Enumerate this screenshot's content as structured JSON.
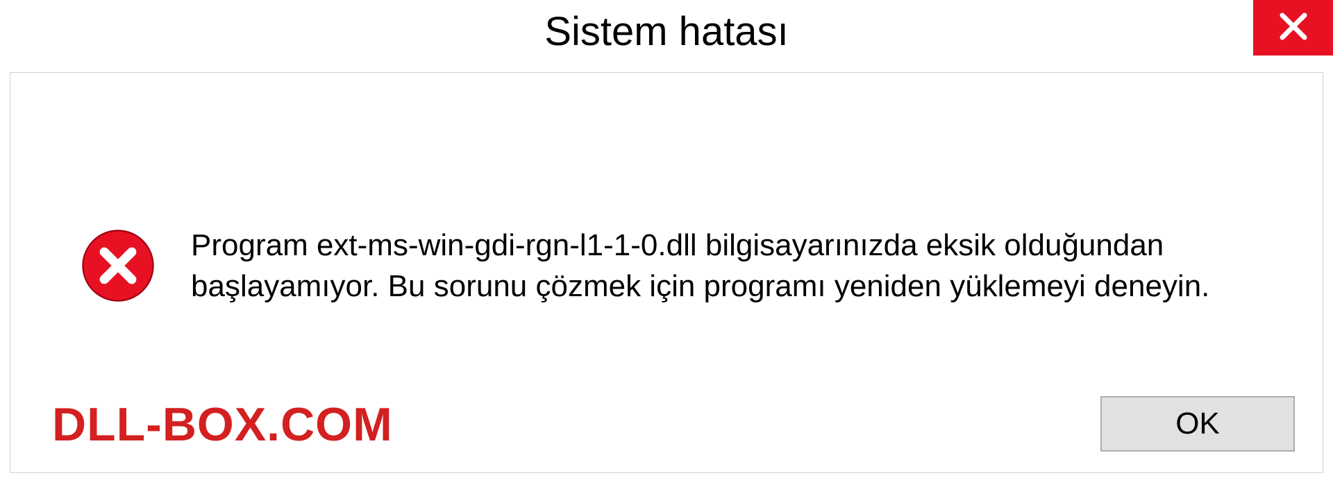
{
  "dialog": {
    "title": "Sistem hatası",
    "message": "Program ext-ms-win-gdi-rgn-l1-1-0.dll bilgisayarınızda eksik olduğundan başlayamıyor. Bu sorunu çözmek için programı yeniden yüklemeyi deneyin.",
    "ok_label": "OK"
  },
  "watermark": "DLL-BOX.COM",
  "colors": {
    "close_bg": "#e81123",
    "error_icon": "#e81123",
    "watermark": "#d32020"
  }
}
